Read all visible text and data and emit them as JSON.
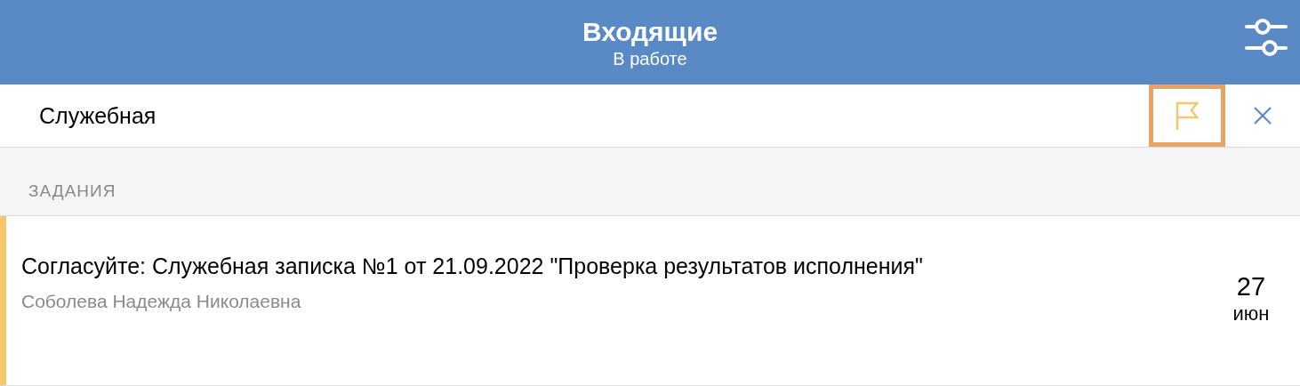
{
  "header": {
    "title": "Входящие",
    "subtitle": "В работе"
  },
  "search": {
    "value": "Служебная",
    "flag_filter": {
      "highlighted": true
    }
  },
  "section": {
    "title": "ЗАДАНИЯ"
  },
  "tasks": [
    {
      "title": "Согласуйте: Служебная записка №1 от 21.09.2022 \"Проверка результатов исполнения\"",
      "author": "Соболева Надежда Николаевна",
      "day": "27",
      "month": "июн",
      "color": "#f8c76c"
    }
  ]
}
